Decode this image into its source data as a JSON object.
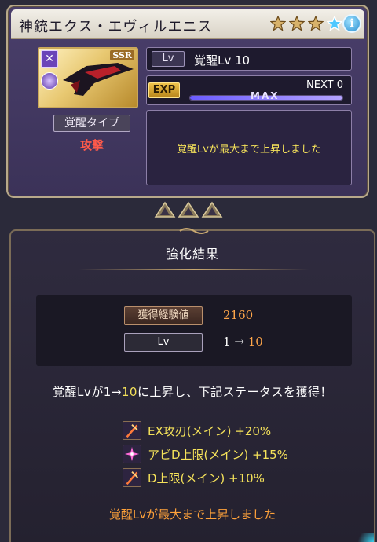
{
  "weapon": {
    "name": "神銃エクス・エヴィルエニス",
    "rarity": "SSR",
    "stars_total": 4,
    "stars_filled": 3,
    "info_icon": "info-icon",
    "element_icon": "dark-element-icon"
  },
  "level": {
    "tag": "Lv",
    "value": "覚醒Lv 10"
  },
  "exp": {
    "tag": "EXP",
    "next_label": "NEXT 0",
    "max_label": "MAX",
    "progress": 1.0
  },
  "awaken_type": {
    "tag": "覚醒タイプ",
    "value": "攻撃"
  },
  "top_message": "覚醒Lvが最大まで上昇しました",
  "result": {
    "title": "強化結果",
    "exp_gain_tag": "獲得経験値",
    "exp_gain_value": "2160",
    "lv_tag": "Lv",
    "lv_from": "1",
    "lv_arrow": "→",
    "lv_to": "10",
    "summary_prefix": "覚醒Lvが",
    "summary_from": "1",
    "summary_arrow": "→",
    "summary_to": "10",
    "summary_suffix": "に上昇し、下記ステータスを獲得！",
    "bonuses": [
      {
        "icon": "attack-sword-icon",
        "text": "EX攻刃(メイン) +20%"
      },
      {
        "icon": "sparkle-skill-icon",
        "text": "アビD上限(メイン) +15%"
      },
      {
        "icon": "attack-sword-icon",
        "text": "D上限(メイン) +10%"
      }
    ],
    "final_message": "覚醒Lvが最大まで上昇しました"
  },
  "colors": {
    "accent_yellow": "#f5e25a",
    "accent_orange": "#ffa64a",
    "attack_red": "#ff5a4a"
  }
}
